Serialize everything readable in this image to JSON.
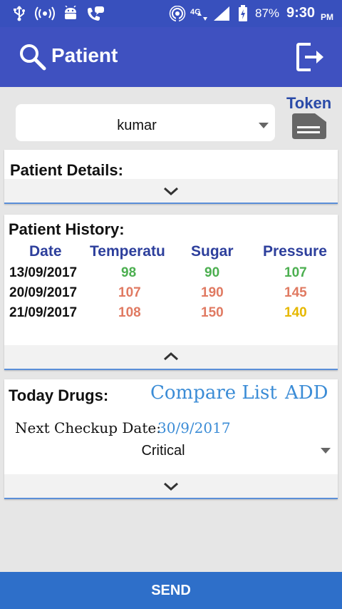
{
  "status_bar": {
    "network": "4G",
    "battery": "87%",
    "time": "9:30",
    "ampm": "PM"
  },
  "app_bar": {
    "title": "Patient"
  },
  "patient_select": {
    "value": "kumar"
  },
  "token": {
    "label": "Token"
  },
  "patient_details": {
    "title": "Patient Details:"
  },
  "patient_history": {
    "title": "Patient History:",
    "columns": [
      "Date",
      "Temperatu",
      "Sugar",
      "Pressure"
    ],
    "rows": [
      {
        "date": "13/09/2017",
        "temperature": "98",
        "sugar": "90",
        "pressure": "107"
      },
      {
        "date": "20/09/2017",
        "temperature": "107",
        "sugar": "190",
        "pressure": "145"
      },
      {
        "date": "21/09/2017",
        "temperature": "108",
        "sugar": "150",
        "pressure": "140"
      }
    ]
  },
  "today_drugs": {
    "title": "Today Drugs:",
    "compare_label": "Compare List",
    "add_label": "ADD",
    "next_checkup_label": "Next Checkup Date:",
    "next_checkup_value": "30/9/2017",
    "status_value": "Critical"
  },
  "send_label": "SEND"
}
